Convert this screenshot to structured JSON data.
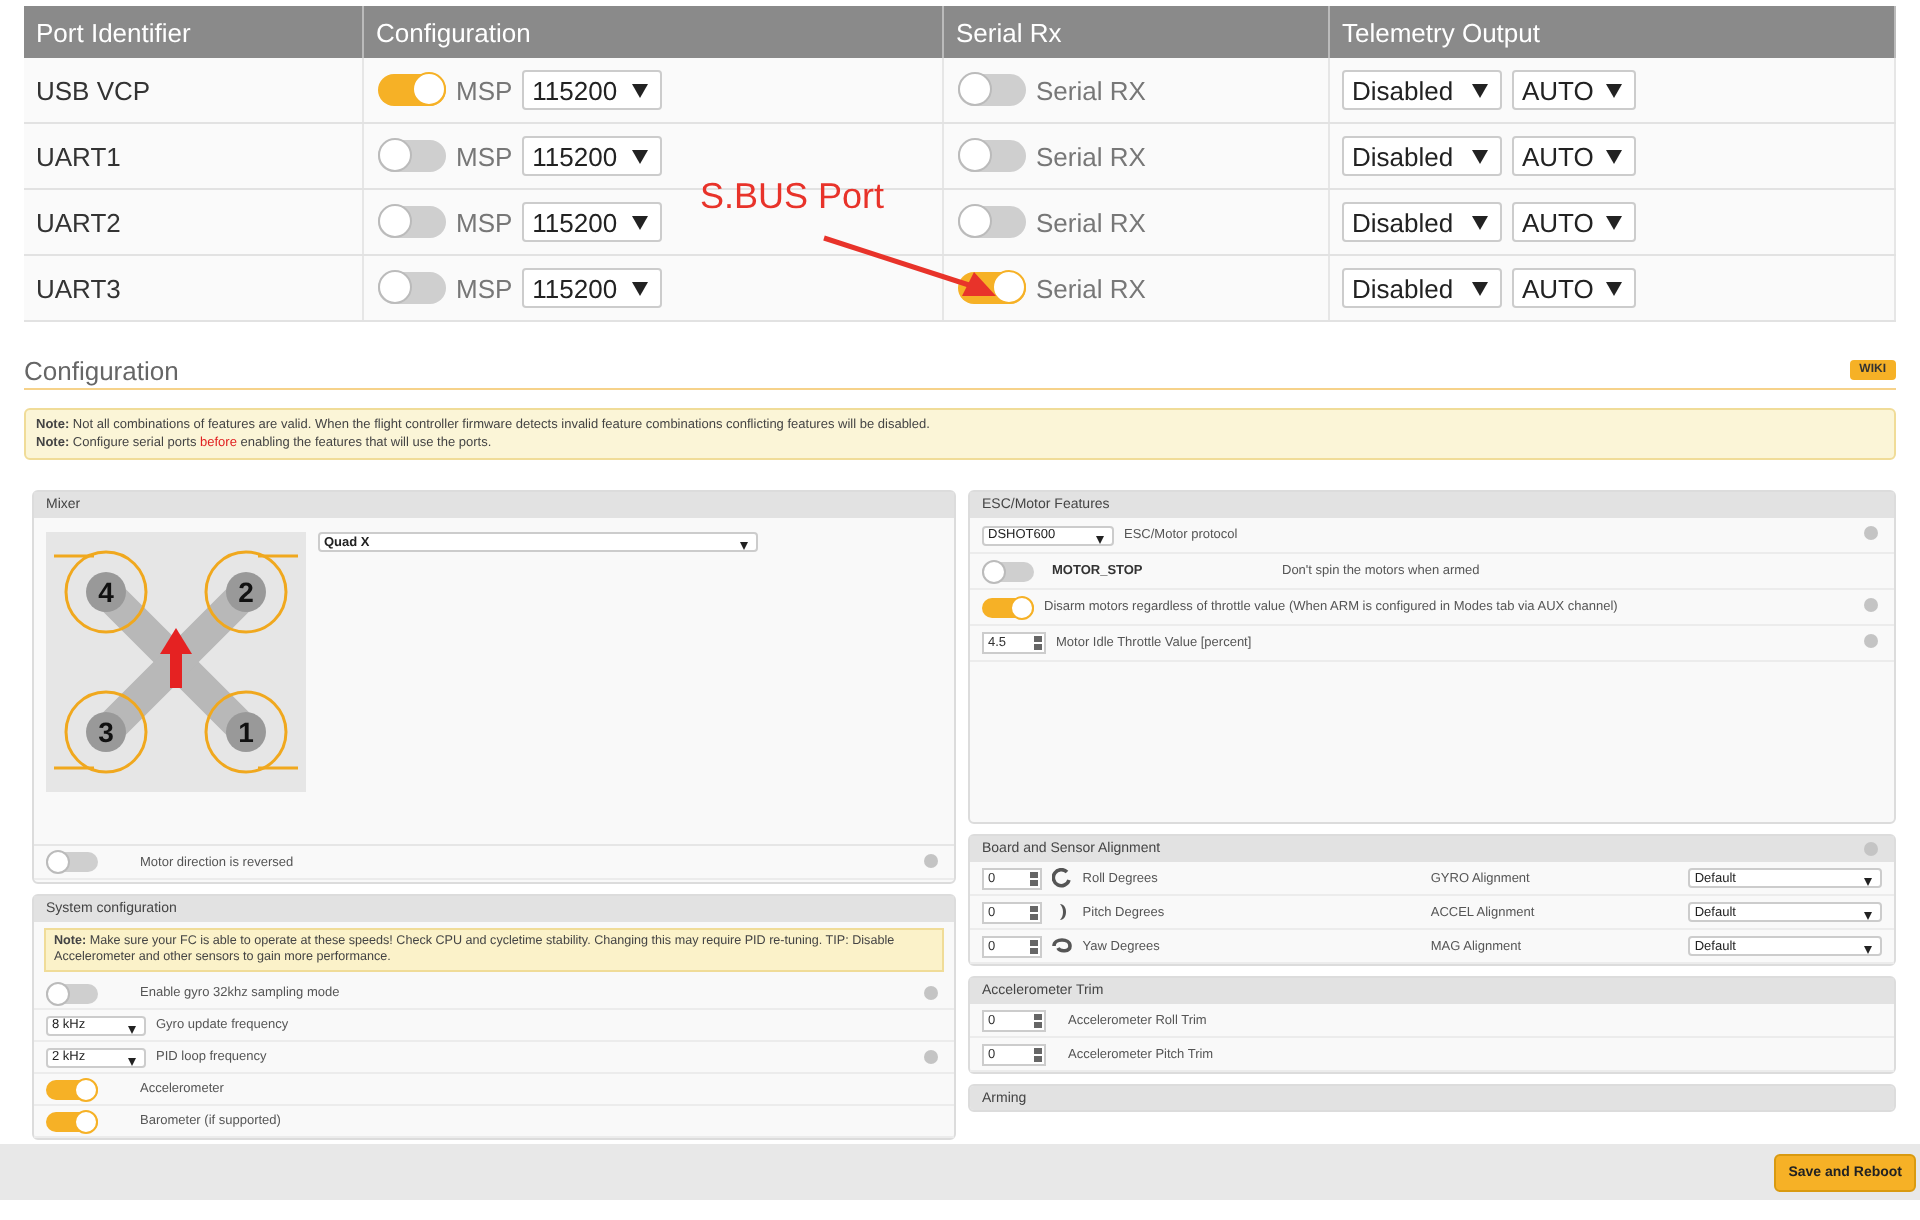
{
  "table": {
    "columns": [
      "Port Identifier",
      "Configuration",
      "Serial Rx",
      "Telemetry Output"
    ],
    "rows": [
      {
        "port": "USB VCP",
        "msp": true,
        "msp_label": "MSP",
        "baud": "115200",
        "serial_rx": false,
        "serial_rx_label": "Serial RX",
        "telemetry": "Disabled",
        "telemetry_baud": "AUTO"
      },
      {
        "port": "UART1",
        "msp": false,
        "msp_label": "MSP",
        "baud": "115200",
        "serial_rx": false,
        "serial_rx_label": "Serial RX",
        "telemetry": "Disabled",
        "telemetry_baud": "AUTO"
      },
      {
        "port": "UART2",
        "msp": false,
        "msp_label": "MSP",
        "baud": "115200",
        "serial_rx": false,
        "serial_rx_label": "Serial RX",
        "telemetry": "Disabled",
        "telemetry_baud": "AUTO"
      },
      {
        "port": "UART3",
        "msp": false,
        "msp_label": "MSP",
        "baud": "115200",
        "serial_rx": true,
        "serial_rx_label": "Serial RX",
        "telemetry": "Disabled",
        "telemetry_baud": "AUTO"
      }
    ]
  },
  "annotation": {
    "text": "S.BUS Port"
  },
  "configuration": {
    "title": "Configuration",
    "wiki": "WIKI",
    "notes": [
      {
        "label": "Note:",
        "parts": [
          {
            "kind": "plain",
            "text": " Not all combinations of features are valid. When the flight controller firmware detects invalid feature combinations conflicting features will be disabled."
          }
        ]
      },
      {
        "label": "Note:",
        "parts": [
          {
            "kind": "plain",
            "text": " Configure serial ports "
          },
          {
            "kind": "warning",
            "text": "before"
          },
          {
            "kind": "plain",
            "text": " enabling the features that will use the ports."
          }
        ]
      }
    ]
  },
  "mixer": {
    "title": "Mixer",
    "motors": [
      "4",
      "2",
      "3",
      "1"
    ],
    "mixer_type": "Quad X",
    "reversed": {
      "label": "Motor direction is reversed",
      "on": false,
      "help": true
    }
  },
  "system": {
    "title": "System configuration",
    "note": {
      "label": "Note:",
      "text": " Make sure your FC is able to operate at these speeds! Check CPU and cycletime stability. Changing this may require PID re-tuning. TIP: Disable Accelerometer and other sensors to gain more performance."
    },
    "rows": [
      {
        "kind": "toggle",
        "on": false,
        "label": "Enable gyro 32khz sampling mode",
        "help": true
      },
      {
        "kind": "select",
        "value": "8 kHz",
        "label": "Gyro update frequency",
        "help": false
      },
      {
        "kind": "select",
        "value": "2 kHz",
        "label": "PID loop frequency",
        "help": true
      },
      {
        "kind": "toggle",
        "on": true,
        "label": "Accelerometer",
        "help": false
      },
      {
        "kind": "toggle",
        "on": true,
        "label": "Barometer (if supported)",
        "help": false
      }
    ]
  },
  "esc": {
    "title": "ESC/Motor Features",
    "rows": [
      {
        "kind": "select",
        "value": "DSHOT600",
        "label": "ESC/Motor protocol",
        "help": true
      },
      {
        "kind": "feature",
        "on": false,
        "name": "MOTOR_STOP",
        "label": "Don't spin the motors when armed",
        "help": false
      },
      {
        "kind": "toggle",
        "on": true,
        "label": "Disarm motors regardless of throttle value (When ARM is configured in Modes tab via AUX channel)",
        "help": true
      },
      {
        "kind": "number",
        "value": "4.5",
        "label": "Motor Idle Throttle Value [percent]",
        "help": true
      }
    ]
  },
  "alignment": {
    "title": "Board and Sensor Alignment",
    "help": true,
    "rows": [
      {
        "value": "0",
        "kind": "roll",
        "label": "Roll Degrees",
        "sensor": "GYRO Alignment",
        "setting": "Default"
      },
      {
        "value": "0",
        "kind": "pitch",
        "label": "Pitch Degrees",
        "sensor": "ACCEL Alignment",
        "setting": "Default"
      },
      {
        "value": "0",
        "kind": "yaw",
        "label": "Yaw Degrees",
        "sensor": "MAG Alignment",
        "setting": "Default"
      }
    ]
  },
  "accel_trim": {
    "title": "Accelerometer Trim",
    "rows": [
      {
        "value": "0",
        "label": "Accelerometer Roll Trim"
      },
      {
        "value": "0",
        "label": "Accelerometer Pitch Trim"
      }
    ]
  },
  "arming": {
    "title": "Arming"
  },
  "footer": {
    "save": "Save and Reboot"
  }
}
